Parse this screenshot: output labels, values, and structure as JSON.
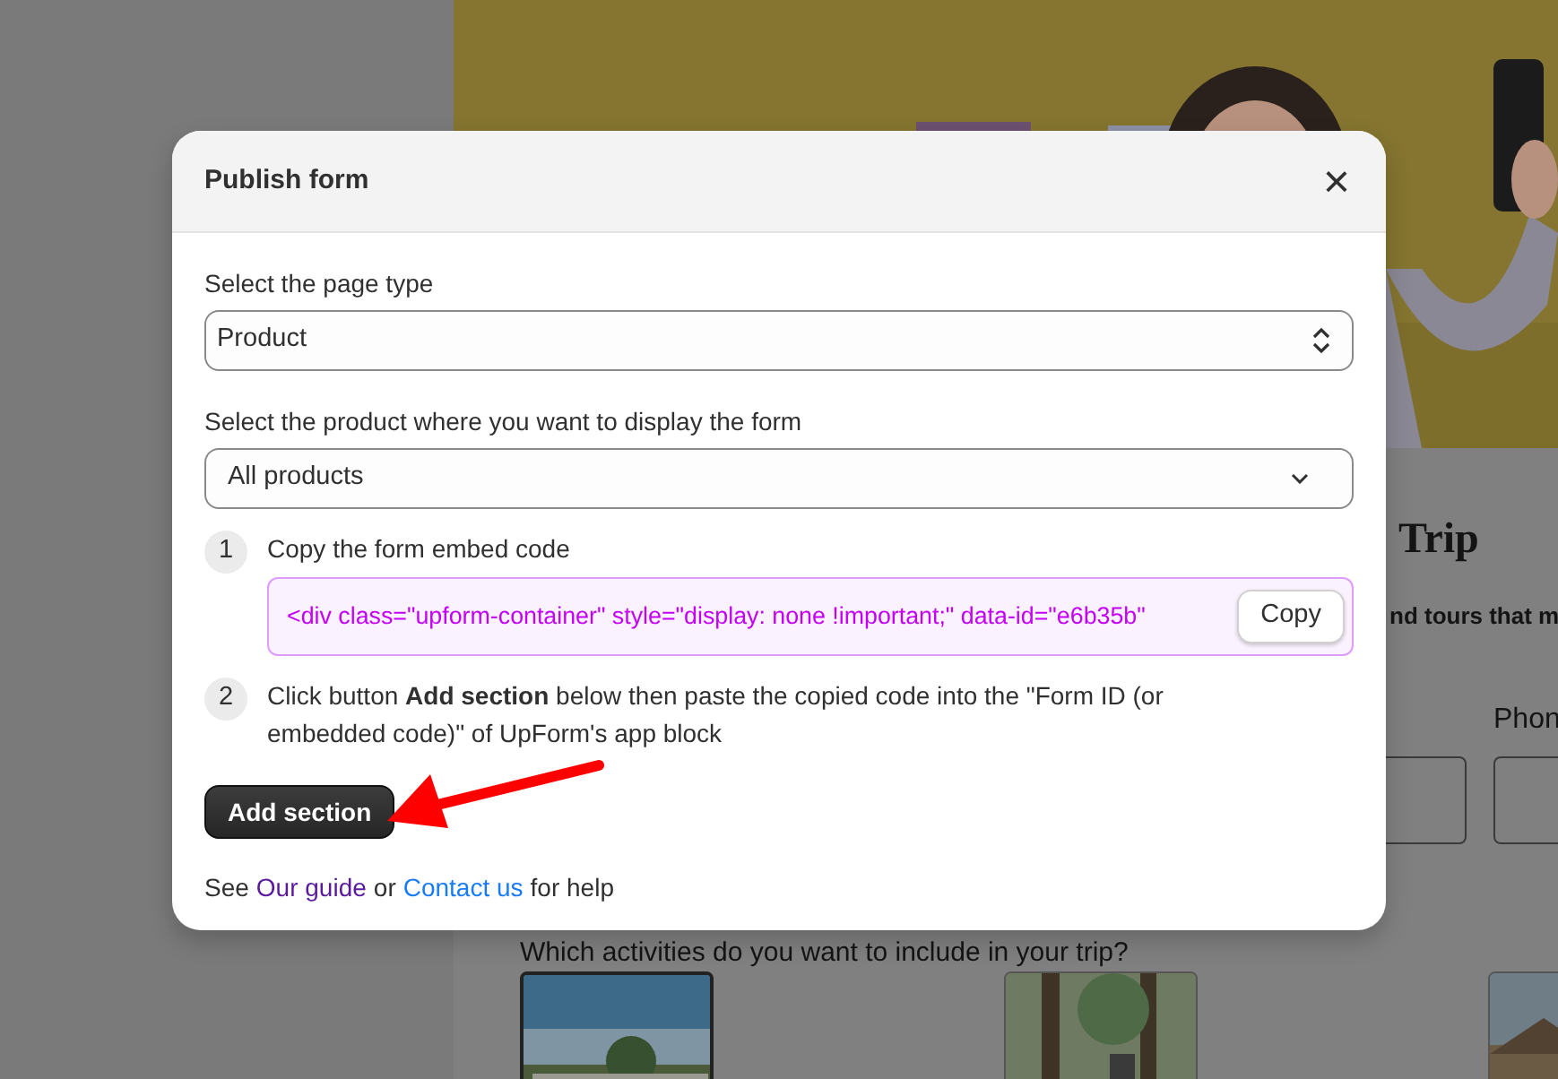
{
  "background_page": {
    "hero": {
      "kind": "picture"
    },
    "heading": "Trip",
    "intro": "nd tours that m",
    "field_label": "Phon",
    "fields": [
      {
        "kind": "text"
      },
      {
        "kind": "text"
      }
    ],
    "question": "Which activities do you want to include in your trip?",
    "activity_cards": [
      {
        "kind": "picture",
        "selected": true
      },
      {
        "kind": "picture",
        "selected": false
      },
      {
        "kind": "picture",
        "selected": false
      }
    ]
  },
  "modal": {
    "title": "Publish form",
    "close": "×",
    "page_type": {
      "label": "Select the page type",
      "value": "Product",
      "kind": "updown"
    },
    "product": {
      "label": "Select the product where you want to display the form",
      "value": "All products",
      "kind": "dropdown"
    },
    "steps": [
      {
        "number": "1",
        "text": "Copy the form embed code",
        "code": "<div class=\"upform-container\" style=\"display: none !important;\" data-id=\"e6b35b\"",
        "copy_button": "Copy"
      },
      {
        "number": "2",
        "text": "Click button **Add section** below then paste the copied code into the \"Form ID (or embedded code)\" of UpForm's app block"
      }
    ],
    "add_button": "Add section",
    "help": [
      {
        "kind": "text",
        "text": "See"
      },
      {
        "kind": "link",
        "text": "Our guide",
        "visited": true
      },
      {
        "kind": "text",
        "text": "or"
      },
      {
        "kind": "link",
        "text": "Contact us",
        "visited": false
      },
      {
        "kind": "text",
        "text": "for help"
      }
    ]
  },
  "annotation": {
    "kind": "arrow",
    "color": "#ff0000"
  }
}
